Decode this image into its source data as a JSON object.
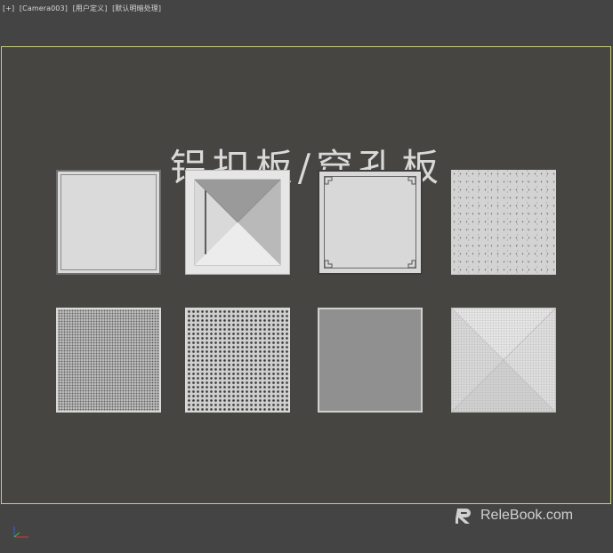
{
  "viewport": {
    "labels": [
      "[+]",
      "[Camera003]",
      "[用户定义]",
      "[默认明暗处理]"
    ]
  },
  "scene": {
    "title": "铝扣板/穿孔板",
    "tiles": [
      {
        "type": "plain-square-panel"
      },
      {
        "type": "pyramid-panel"
      },
      {
        "type": "corner-ornament-panel"
      },
      {
        "type": "speckled-acoustic-panel"
      },
      {
        "type": "fine-perforated-panel"
      },
      {
        "type": "hex-perforated-panel"
      },
      {
        "type": "micro-perforated-panel"
      },
      {
        "type": "diagonal-perforated-panel"
      }
    ]
  },
  "watermark": {
    "text": "ReleBook.com"
  },
  "colors": {
    "background": "#444444",
    "safe_frame_border": "#c7cf7a",
    "title": "#d9d9d9",
    "axis_x": "#d23a3a",
    "axis_y": "#3fbf3f",
    "axis_z": "#3a5fd2"
  }
}
